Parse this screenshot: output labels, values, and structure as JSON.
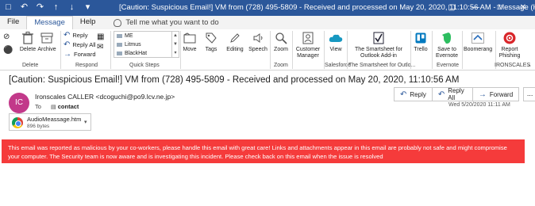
{
  "titlebar": {
    "title": "[Caution: Suspicious Email!] VM from (728) 495-5809 - Received and processed on May 20, 2020, 11:10:56 AM  -  Message (HTML)"
  },
  "tabs": [
    {
      "label": "File",
      "active": false
    },
    {
      "label": "Message",
      "active": true
    },
    {
      "label": "Help",
      "active": false
    }
  ],
  "tell_me": "Tell me what you want to do",
  "ribbon": {
    "delete_group": {
      "delete": "Delete",
      "archive": "Archive",
      "label": "Delete"
    },
    "respond_group": {
      "reply": "Reply",
      "reply_all": "Reply All",
      "forward": "Forward",
      "label": "Respond"
    },
    "quick_steps": {
      "items": [
        "ME",
        "Litmus",
        "BlackHat"
      ],
      "label": "Quick Steps"
    },
    "move": "Move",
    "tags": "Tags",
    "editing": "Editing",
    "speech": "Speech",
    "zoom": {
      "button": "Zoom",
      "label": "Zoom"
    },
    "customer_manager": "Customer Manager",
    "view": "View",
    "salesforce_label": "Salesforce",
    "smartsheet": {
      "button": "The Smartsheet for Outlook Add-in",
      "label": "The Smartsheet for Outlo..."
    },
    "trello": "Trello",
    "evernote": {
      "button": "Save to Evernote",
      "label": "Evernote"
    },
    "boomerang": "Boomerang",
    "report": {
      "button": "Report Phishing",
      "label": "IRONSCALES"
    }
  },
  "message": {
    "subject": "[Caution: Suspicious Email!] VM from (728) 495-5809 - Received and processed on May 20, 2020, 11:10:56 AM",
    "avatar_initials": "IC",
    "sender": "Ironscales CALLER <dcoguchi@po9.lcv.ne.jp>",
    "to_label": "To",
    "to_recipient": "contact",
    "date": "Wed 5/20/2020 11:11 AM",
    "actions": {
      "reply": "Reply",
      "reply_all": "Reply All",
      "forward": "Forward",
      "more": "..."
    },
    "attachment": {
      "name": "AudioMeassage.htm",
      "size": "896 bytes"
    },
    "banner": "This email was reported as malicious by your co-workers, please handle this email with great care! Links and attachments appear in this email are probably not safe and might compromise your computer. The Security team is now aware and is investigating this incident. Please check back on this email when the issue is resolved"
  },
  "colors": {
    "titlebar": "#2b579a",
    "banner": "#f53b3b",
    "avatar": "#c2398a"
  }
}
